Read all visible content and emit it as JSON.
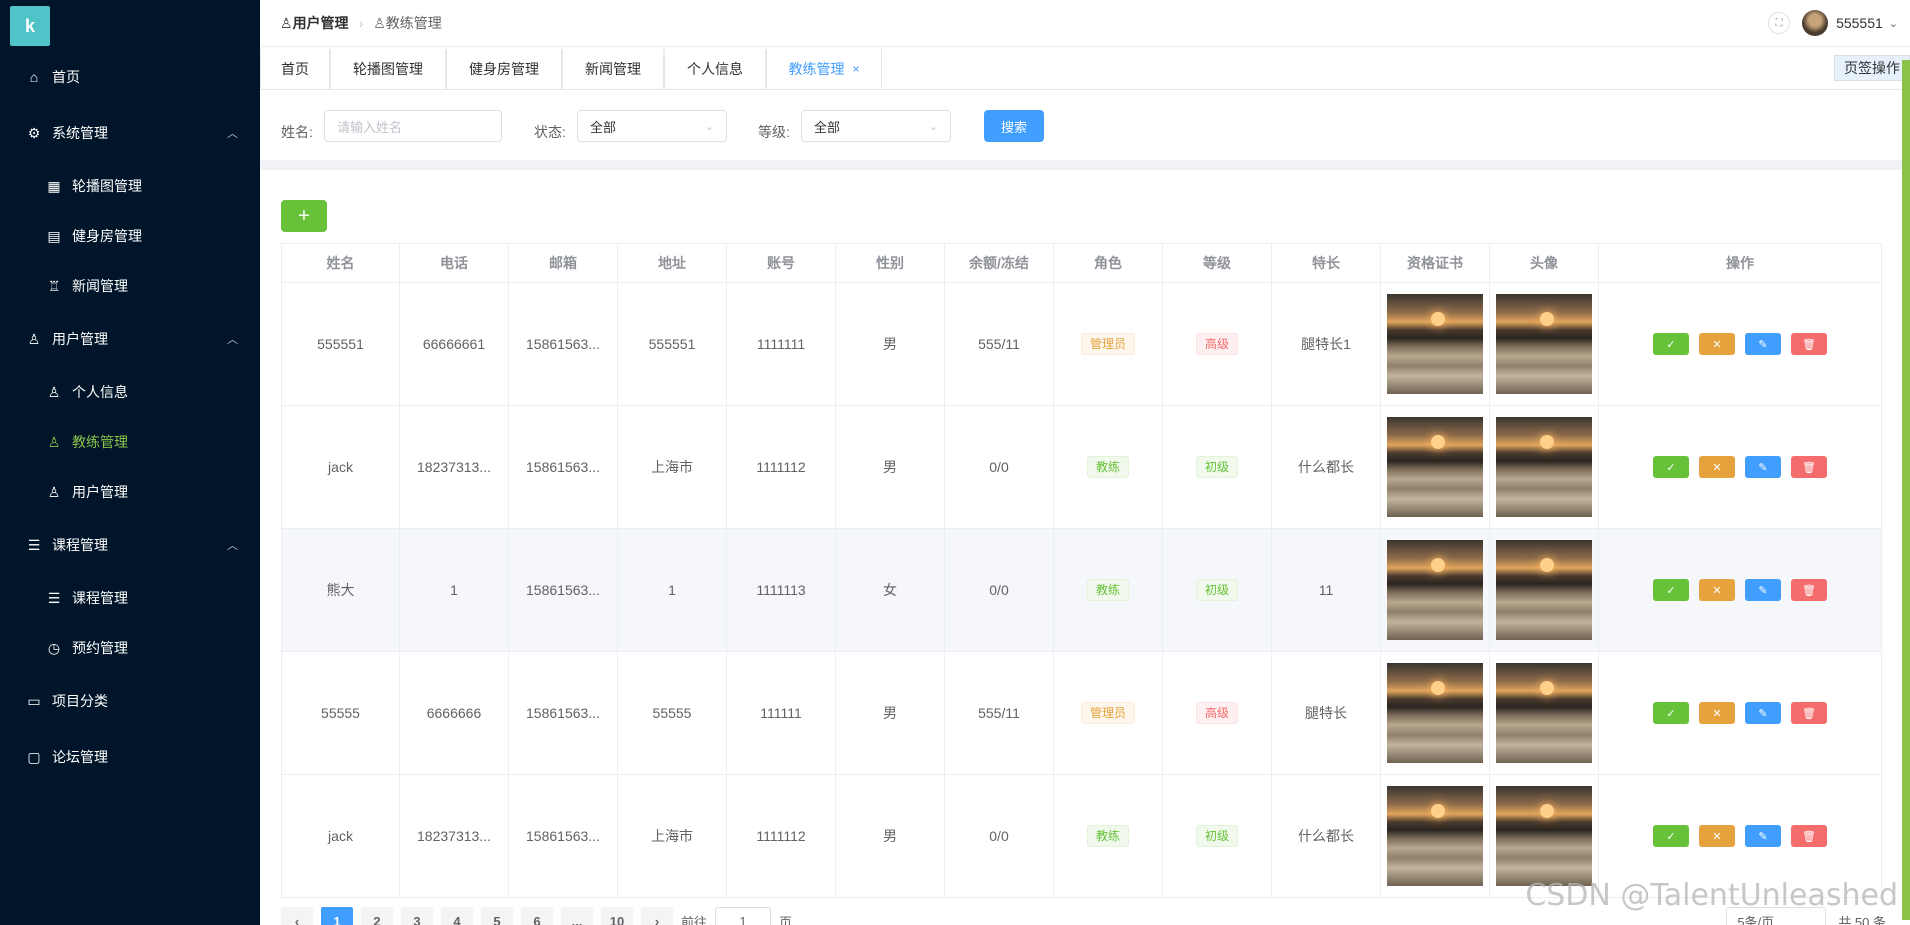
{
  "sidebar": {
    "items": [
      {
        "label": "首页",
        "icon": "home-icon"
      },
      {
        "label": "系统管理",
        "icon": "gear-icon"
      },
      {
        "label": "轮播图管理",
        "icon": "grid-icon"
      },
      {
        "label": "健身房管理",
        "icon": "film-icon"
      },
      {
        "label": "新闻管理",
        "icon": "medal-icon"
      },
      {
        "label": "用户管理",
        "icon": "user-icon"
      },
      {
        "label": "个人信息",
        "icon": "user-icon"
      },
      {
        "label": "教练管理",
        "icon": "user-icon"
      },
      {
        "label": "用户管理",
        "icon": "user-icon"
      },
      {
        "label": "课程管理",
        "icon": "sliders-icon"
      },
      {
        "label": "课程管理",
        "icon": "sliders-icon"
      },
      {
        "label": "预约管理",
        "icon": "clock-icon"
      },
      {
        "label": "项目分类",
        "icon": "briefcase-icon"
      },
      {
        "label": "论坛管理",
        "icon": "chat-icon"
      }
    ]
  },
  "header": {
    "breadcrumb": [
      "用户管理",
      "教练管理"
    ],
    "username": "555551"
  },
  "tags": {
    "items": [
      "首页",
      "轮播图管理",
      "健身房管理",
      "新闻管理",
      "个人信息",
      "教练管理"
    ],
    "close": "×",
    "ops_label": "页签操作"
  },
  "search": {
    "name_label": "姓名:",
    "name_placeholder": "请输入姓名",
    "status_label": "状态:",
    "status_value": "全部",
    "level_label": "等级:",
    "level_value": "全部",
    "button": "搜索"
  },
  "toolbar": {
    "add_label": "+"
  },
  "table": {
    "headers": [
      "姓名",
      "电话",
      "邮箱",
      "地址",
      "账号",
      "性别",
      "余额/冻结",
      "角色",
      "等级",
      "特长",
      "资格证书",
      "头像",
      "操作"
    ],
    "rows": [
      {
        "name": "555551",
        "phone": "66666661",
        "email": "15861563...",
        "address": "555551",
        "account": "1111111",
        "gender": "男",
        "balance": "555/11",
        "role": "管理员",
        "level": "高级",
        "specialty": "腿特长1"
      },
      {
        "name": "jack",
        "phone": "18237313...",
        "email": "15861563...",
        "address": "上海市",
        "account": "1111112",
        "gender": "男",
        "balance": "0/0",
        "role": "教练",
        "level": "初级",
        "specialty": "什么都长"
      },
      {
        "name": "熊大",
        "phone": "1",
        "email": "15861563...",
        "address": "1",
        "account": "1111113",
        "gender": "女",
        "balance": "0/0",
        "role": "教练",
        "level": "初级",
        "specialty": "11"
      },
      {
        "name": "55555",
        "phone": "6666666",
        "email": "15861563...",
        "address": "55555",
        "account": "111111",
        "gender": "男",
        "balance": "555/11",
        "role": "管理员",
        "level": "高级",
        "specialty": "腿特长"
      },
      {
        "name": "jack",
        "phone": "18237313...",
        "email": "15861563...",
        "address": "上海市",
        "account": "1111112",
        "gender": "男",
        "balance": "0/0",
        "role": "教练",
        "level": "初级",
        "specialty": "什么都长"
      }
    ]
  },
  "pagination": {
    "prev": "‹",
    "pages": [
      "1",
      "2",
      "3",
      "4",
      "5",
      "6",
      "...",
      "10"
    ],
    "next": "›",
    "goto_label": "前往",
    "goto_value": "1",
    "page_unit": "页",
    "page_size": "5条/页",
    "total": "共 50 条"
  },
  "watermark": "CSDN @TalentUnleashed",
  "colors": {
    "sidebar_bg": "#001529",
    "active": "#8bc34a",
    "primary": "#409eff",
    "success": "#67c23a",
    "warning": "#e6a23c",
    "danger": "#f56c6c"
  }
}
